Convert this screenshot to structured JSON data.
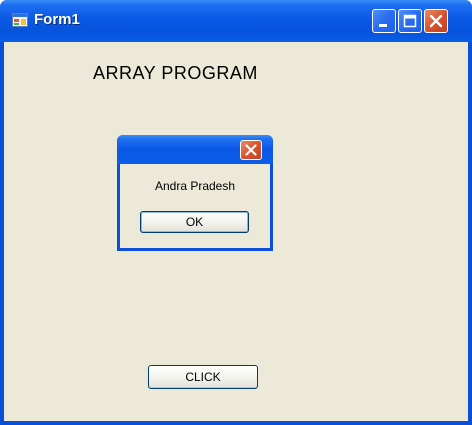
{
  "window": {
    "title": "Form1",
    "icon": "form-app-icon",
    "controls": {
      "minimize": "minimize-icon",
      "maximize": "maximize-icon",
      "close": "close-icon"
    }
  },
  "form": {
    "heading": "ARRAY PROGRAM",
    "click_button_label": "CLICK"
  },
  "message_box": {
    "message": "Andra Pradesh",
    "ok_label": "OK",
    "close_icon": "close-icon"
  },
  "colors": {
    "titlebar_blue": "#0a58e6",
    "window_background": "#ece9d8",
    "close_red": "#d9542f",
    "button_border": "#003c74"
  }
}
